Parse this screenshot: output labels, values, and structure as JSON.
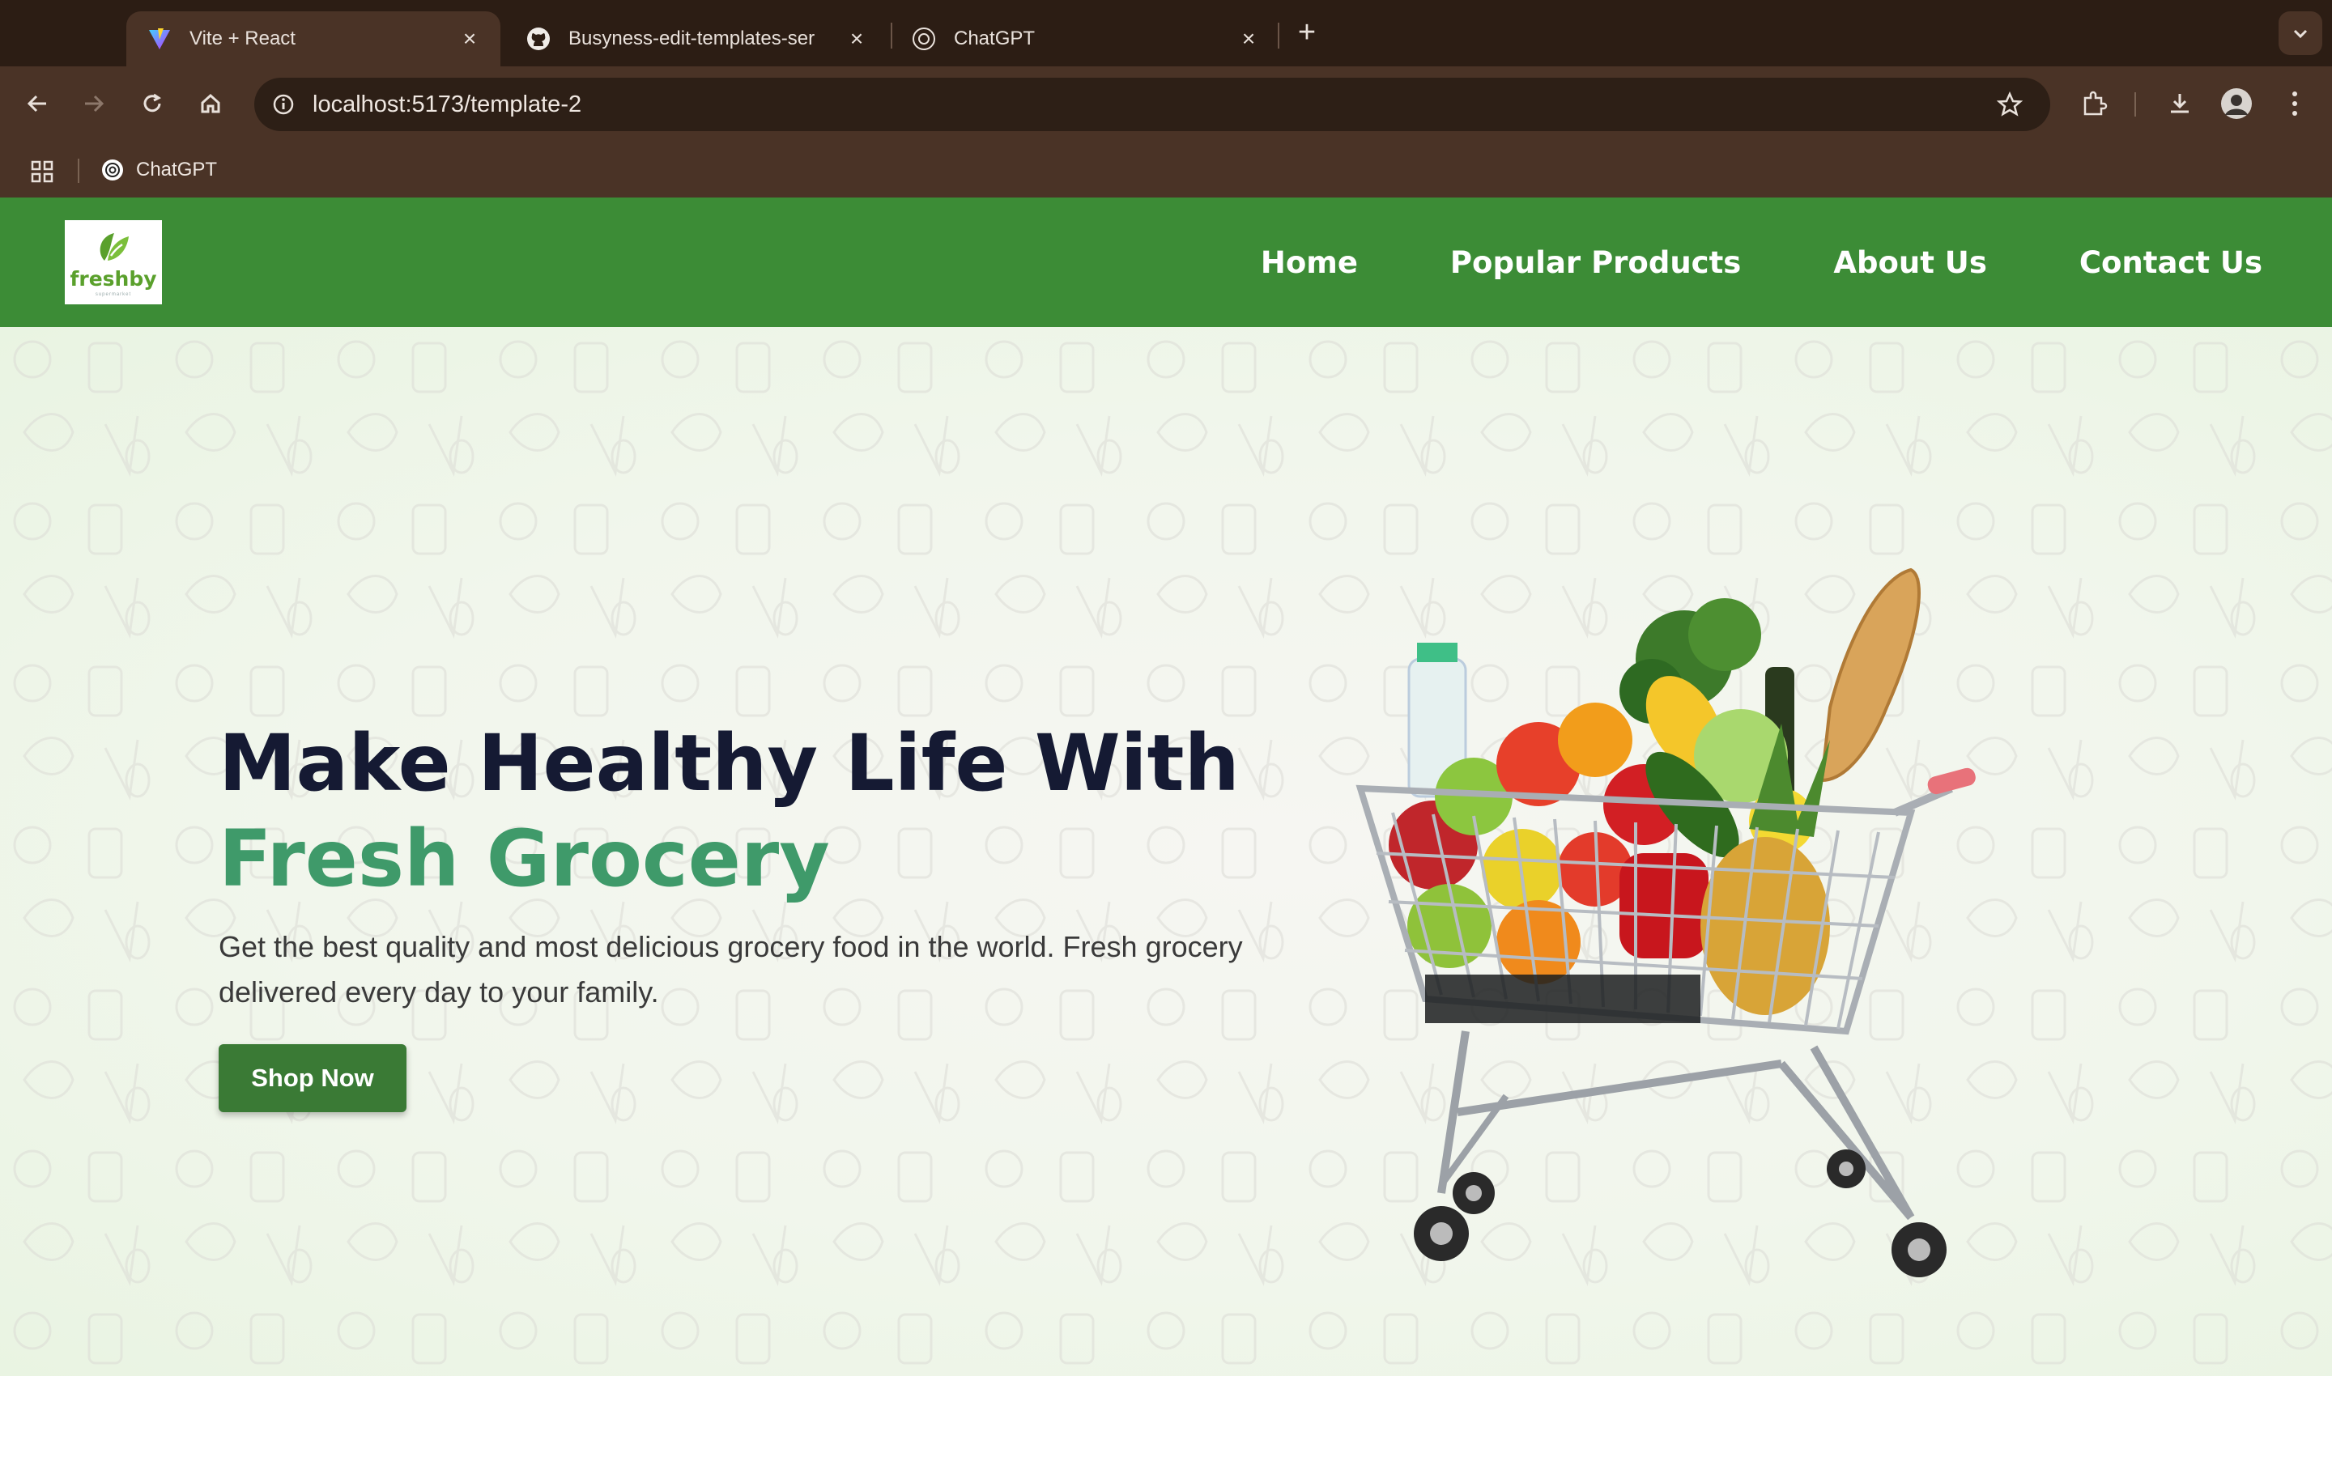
{
  "browser": {
    "tabs": [
      {
        "title": "Vite + React",
        "favicon": "vite-icon",
        "active": true
      },
      {
        "title": "Busyness-edit-templates-ser",
        "favicon": "github-icon",
        "active": false
      },
      {
        "title": "ChatGPT",
        "favicon": "chatgpt-icon",
        "active": false
      }
    ],
    "url": "localhost:5173/template-2",
    "bookmarks": [
      {
        "label": "ChatGPT",
        "favicon": "chatgpt-icon"
      }
    ]
  },
  "site": {
    "logo": {
      "text": "freshby",
      "tagline": "supermarket"
    },
    "nav": [
      "Home",
      "Popular Products",
      "About Us",
      "Contact Us"
    ],
    "hero": {
      "title_line1": "Make Healthy Life With",
      "title_line2": "Fresh Grocery",
      "subtitle": "Get the best quality and most delicious grocery food in the world. Fresh grocery delivered every day to your family.",
      "cta": "Shop Now",
      "image": "grocery-cart-illustration"
    }
  },
  "colors": {
    "tabstrip": "#2c1d14",
    "toolbar": "#4a3326",
    "nav_bg": "#3c8c36",
    "heading_dark": "#151a33",
    "heading_green": "#3f9a6a",
    "button": "#3a7a35"
  }
}
